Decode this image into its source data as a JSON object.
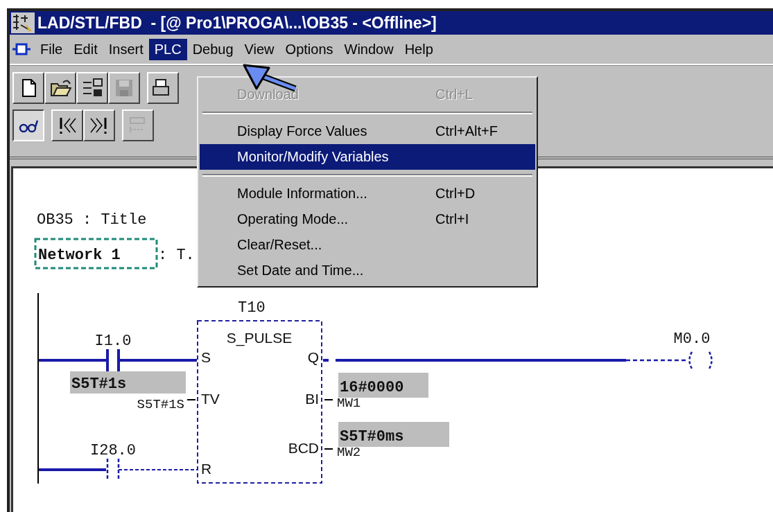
{
  "window": {
    "title": "LAD/STL/FBD  - [@ Pro1\\PROGA\\...\\OB35 - <Offline>]"
  },
  "menu_bar": [
    {
      "label": "File",
      "selected": false
    },
    {
      "label": "Edit",
      "selected": false
    },
    {
      "label": "Insert",
      "selected": false
    },
    {
      "label": "PLC",
      "selected": true
    },
    {
      "label": "Debug",
      "selected": false
    },
    {
      "label": "View",
      "selected": false
    },
    {
      "label": "Options",
      "selected": false
    },
    {
      "label": "Window",
      "selected": false
    },
    {
      "label": "Help",
      "selected": false
    }
  ],
  "toolbar_rows": [
    [
      {
        "kind": "new",
        "pressed": false,
        "disabled": false
      },
      {
        "kind": "open",
        "pressed": false,
        "disabled": false
      },
      {
        "kind": "network",
        "pressed": false,
        "disabled": false
      },
      {
        "kind": "save",
        "pressed": false,
        "disabled": true
      },
      {
        "kind": "print",
        "pressed": false,
        "disabled": false
      }
    ],
    [
      {
        "kind": "monitor",
        "pressed": true,
        "disabled": false
      },
      {
        "kind": "first",
        "pressed": false,
        "disabled": false
      },
      {
        "kind": "last",
        "pressed": false,
        "disabled": false
      },
      {
        "kind": "ladder",
        "pressed": false,
        "disabled": true
      }
    ]
  ],
  "dropdown": [
    {
      "kind": "item",
      "label": "Download",
      "shortcut": "Ctrl+L",
      "disabled": true,
      "selected": false
    },
    {
      "kind": "separator"
    },
    {
      "kind": "item",
      "label": "Display Force Values",
      "shortcut": "Ctrl+Alt+F",
      "disabled": false,
      "selected": false
    },
    {
      "kind": "item",
      "label": "Monitor/Modify Variables",
      "disabled": false,
      "selected": true
    },
    {
      "kind": "separator"
    },
    {
      "kind": "item",
      "label": "Module Information...",
      "shortcut": "Ctrl+D",
      "disabled": false,
      "selected": false
    },
    {
      "kind": "item",
      "label": "Operating Mode...",
      "shortcut": "Ctrl+I",
      "disabled": false,
      "selected": false
    },
    {
      "kind": "item",
      "label": "Clear/Reset...",
      "disabled": false,
      "selected": false
    },
    {
      "kind": "item",
      "label": "Set Date and Time...",
      "disabled": false,
      "selected": false
    }
  ],
  "editor": {
    "block_title": "OB35 : Title",
    "network": {
      "label": "Network 1",
      "title": ": T.",
      "selected": true
    },
    "ladder": {
      "timer": {
        "name": "T10",
        "type": "S_PULSE",
        "inputs": [
          {
            "pin": "S"
          },
          {
            "pin": "TV",
            "operand": "S5T#1S",
            "monitor": "S5T#1s"
          },
          {
            "pin": "R"
          }
        ],
        "outputs": [
          {
            "pin": "Q"
          },
          {
            "pin": "BI",
            "operand": "MW1",
            "monitor": "16#0000"
          },
          {
            "pin": "BCD",
            "operand": "MW2",
            "monitor": "S5T#0ms"
          }
        ]
      },
      "contacts": [
        {
          "address": "I1.0",
          "energized": true
        },
        {
          "address": "I28.0",
          "energized": false
        }
      ],
      "coil": {
        "address": "M0.0",
        "energized": false
      }
    }
  }
}
